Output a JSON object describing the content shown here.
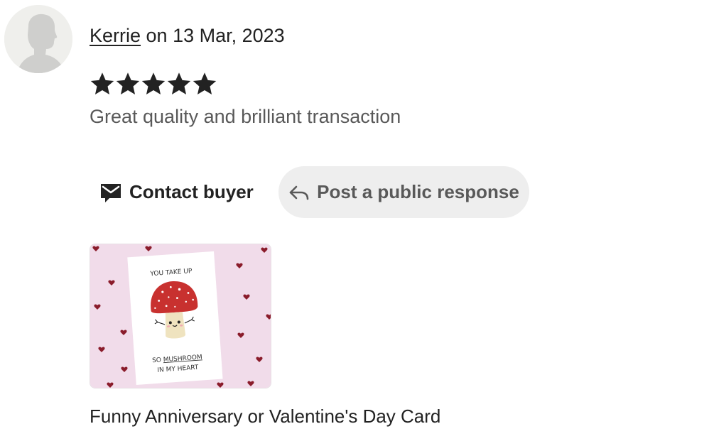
{
  "review": {
    "reviewer_name": "Kerrie",
    "date_text": " on 13 Mar, 2023",
    "rating": 5,
    "rating_max": 5,
    "text": "Great quality and brilliant transaction"
  },
  "actions": {
    "contact_label": "Contact buyer",
    "contact_icon": "envelope-icon",
    "public_response_label": "Post a public response",
    "public_response_icon": "reply-arrow-icon"
  },
  "product": {
    "title": "Funny Anniversary or Valentine's Day Card",
    "card_line_1": "YOU TAKE UP",
    "card_line_2_prefix": "SO ",
    "card_line_2_emph": "MUSHROOM",
    "card_line_3": "IN MY HEART"
  },
  "colors": {
    "star": "#222222",
    "button_bg": "#eeeeee",
    "muted_text": "#595959",
    "card_background": "#f1dcea",
    "mushroom_cap": "#c8312f",
    "heart": "#8a1c2b"
  }
}
